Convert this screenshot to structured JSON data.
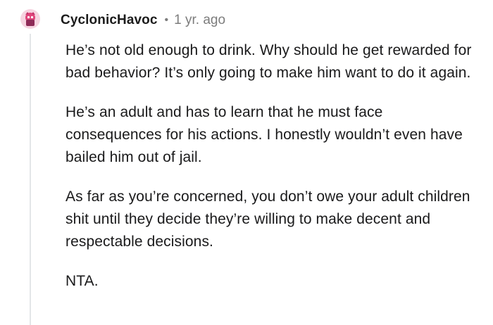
{
  "comment": {
    "username": "CyclonicHavoc",
    "separator": "•",
    "timestamp": "1 yr. ago",
    "avatar_icon": "user-avatar-icon",
    "paragraphs": [
      "He’s not old enough to drink. Why should he get rewarded for bad behavior? It’s only going to make him want to do it again.",
      "He’s an adult and has to learn that he must face consequences for his actions. I honestly wouldn’t even have bailed him out of jail.",
      "As far as you’re concerned, you don’t owe your adult children shit until they decide they’re willing to make decent and respectable decisions.",
      "NTA."
    ]
  },
  "colors": {
    "thread_line": "#e3e6e8",
    "meta_text": "#7c7c7c",
    "body_text": "#1a1a1b",
    "avatar_primary": "#e0457b"
  }
}
